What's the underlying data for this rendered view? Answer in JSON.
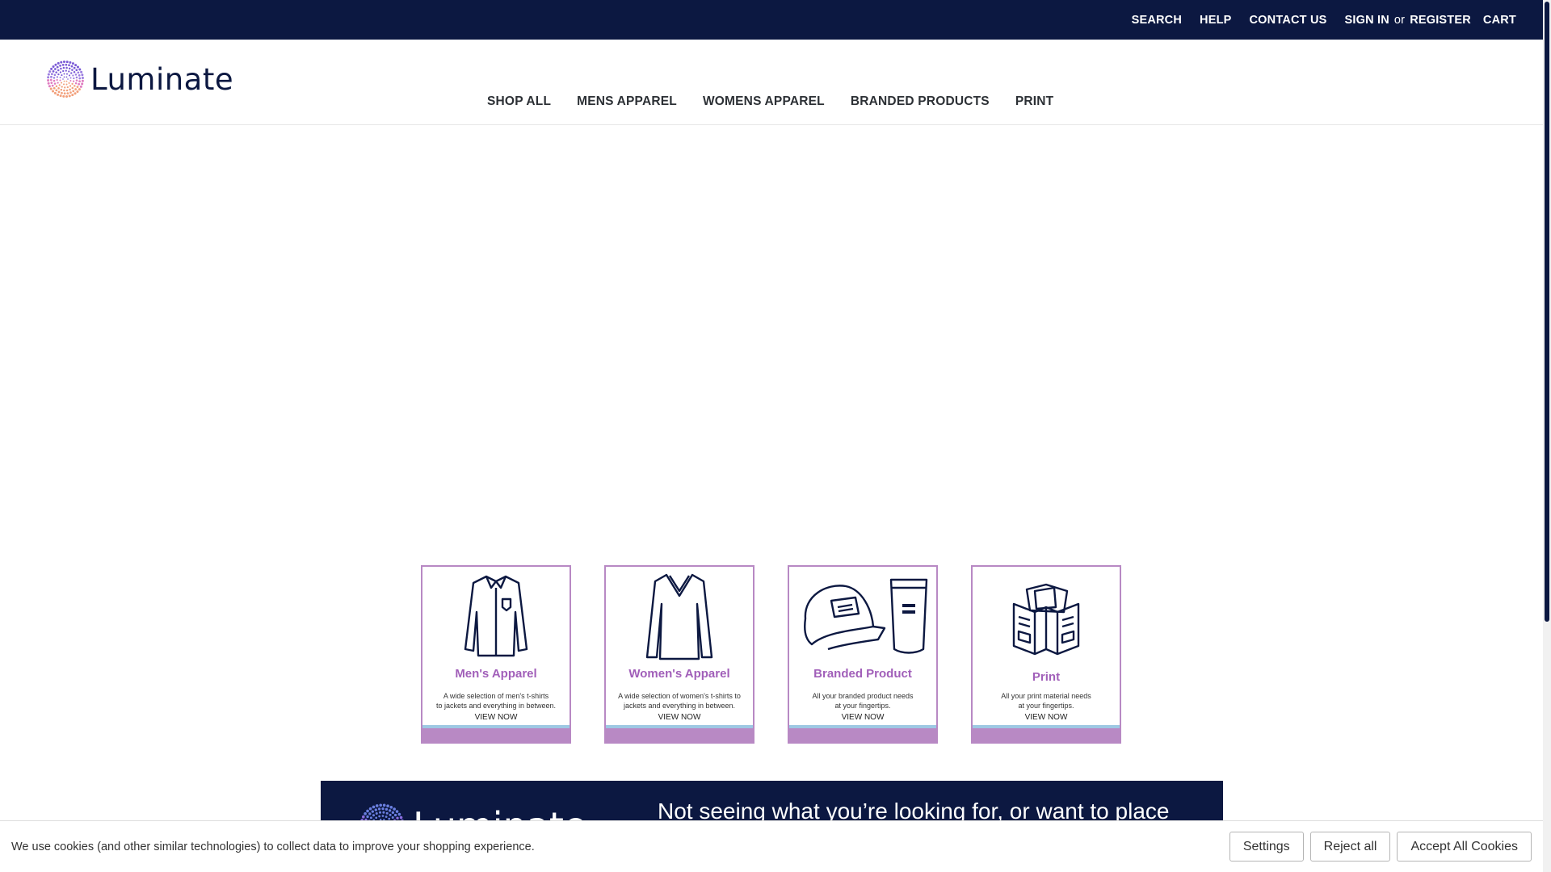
{
  "topbar": {
    "links": [
      "SEARCH",
      "HELP",
      "CONTACT US"
    ],
    "sign_in": "SIGN IN",
    "or": "or",
    "register": "REGISTER",
    "cart": "CART",
    "bg_color": "#0c1841"
  },
  "header": {
    "logo_text": "Luminate",
    "nav": [
      "SHOP ALL",
      "MENS APPAREL",
      "WOMENS APPAREL",
      "BRANDED PRODUCTS",
      "PRINT"
    ]
  },
  "cards": [
    {
      "title": "Men's Apparel",
      "desc_1": "A wide selection of men's t-shirts",
      "desc_2": "to jackets and everything in between.",
      "cta": "VIEW NOW",
      "icon": "mens-shirt-icon"
    },
    {
      "title": "Women's Apparel",
      "desc_1": "A wide selection of women's t-shirts to",
      "desc_2": "jackets and everything in between.",
      "cta": "VIEW NOW",
      "icon": "womens-top-icon"
    },
    {
      "title": "Branded Product",
      "desc_1": "All your branded product needs",
      "desc_2": "at your fingertips.",
      "cta": "VIEW NOW",
      "icon": "cap-tumbler-icon"
    },
    {
      "title": "Print",
      "desc_1": "All your print material needs",
      "desc_2": "at your fingertips.",
      "cta": "VIEW NOW",
      "icon": "print-brochure-icon"
    }
  ],
  "banner": {
    "logo_text": "Luminate",
    "text": "Not seeing what you’re looking for, or want to place"
  },
  "cookie": {
    "message": "We use cookies (and other similar technologies) to collect data to improve your shopping experience.",
    "settings": "Settings",
    "reject": "Reject all",
    "accept": "Accept All Cookies"
  },
  "colors": {
    "navy": "#0c1841",
    "accent_purple": "#b889c4",
    "title_purple": "#a15fb9",
    "accent_blue": "#9ec8e3"
  }
}
